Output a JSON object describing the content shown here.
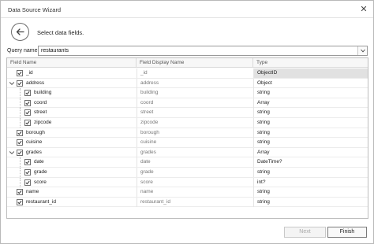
{
  "window": {
    "title": "Data Source Wizard"
  },
  "page": {
    "heading": "Select data fields."
  },
  "query": {
    "label": "Query name:",
    "value": "restaurants"
  },
  "grid": {
    "columns": [
      "Field Name",
      "Field Display Name",
      "Type"
    ],
    "rows": [
      {
        "name": "_id",
        "display": "_id",
        "type": "ObjectID",
        "level": 0,
        "expandable": false,
        "checked": true,
        "selected": true
      },
      {
        "name": "address",
        "display": "address",
        "type": "Object",
        "level": 0,
        "expandable": true,
        "checked": true,
        "selected": false
      },
      {
        "name": "building",
        "display": "building",
        "type": "string",
        "level": 1,
        "expandable": false,
        "checked": true,
        "selected": false
      },
      {
        "name": "coord",
        "display": "coord",
        "type": "Array",
        "level": 1,
        "expandable": false,
        "checked": true,
        "selected": false
      },
      {
        "name": "street",
        "display": "street",
        "type": "string",
        "level": 1,
        "expandable": false,
        "checked": true,
        "selected": false
      },
      {
        "name": "zipcode",
        "display": "zipcode",
        "type": "string",
        "level": 1,
        "expandable": false,
        "checked": true,
        "selected": false
      },
      {
        "name": "borough",
        "display": "borough",
        "type": "string",
        "level": 0,
        "expandable": false,
        "checked": true,
        "selected": false
      },
      {
        "name": "cuisine",
        "display": "cuisine",
        "type": "string",
        "level": 0,
        "expandable": false,
        "checked": true,
        "selected": false
      },
      {
        "name": "grades",
        "display": "grades",
        "type": "Array",
        "level": 0,
        "expandable": true,
        "checked": true,
        "selected": false
      },
      {
        "name": "date",
        "display": "date",
        "type": "DateTime?",
        "level": 1,
        "expandable": false,
        "checked": true,
        "selected": false
      },
      {
        "name": "grade",
        "display": "grade",
        "type": "string",
        "level": 1,
        "expandable": false,
        "checked": true,
        "selected": false
      },
      {
        "name": "score",
        "display": "score",
        "type": "int?",
        "level": 1,
        "expandable": false,
        "checked": true,
        "selected": false
      },
      {
        "name": "name",
        "display": "name",
        "type": "string",
        "level": 0,
        "expandable": false,
        "checked": true,
        "selected": false
      },
      {
        "name": "restaurant_id",
        "display": "restaurant_id",
        "type": "string",
        "level": 0,
        "expandable": false,
        "checked": true,
        "selected": false
      }
    ]
  },
  "buttons": {
    "next": "Next",
    "finish": "Finish"
  },
  "icons": {
    "back": "arrow-left-icon",
    "close": "close-icon",
    "dropdown": "chevron-down-icon",
    "expand": "chevron-down-icon",
    "check": "check-icon"
  },
  "colors": {
    "accent": "#6c6c6c",
    "selected_row": "#e1e1e1"
  }
}
